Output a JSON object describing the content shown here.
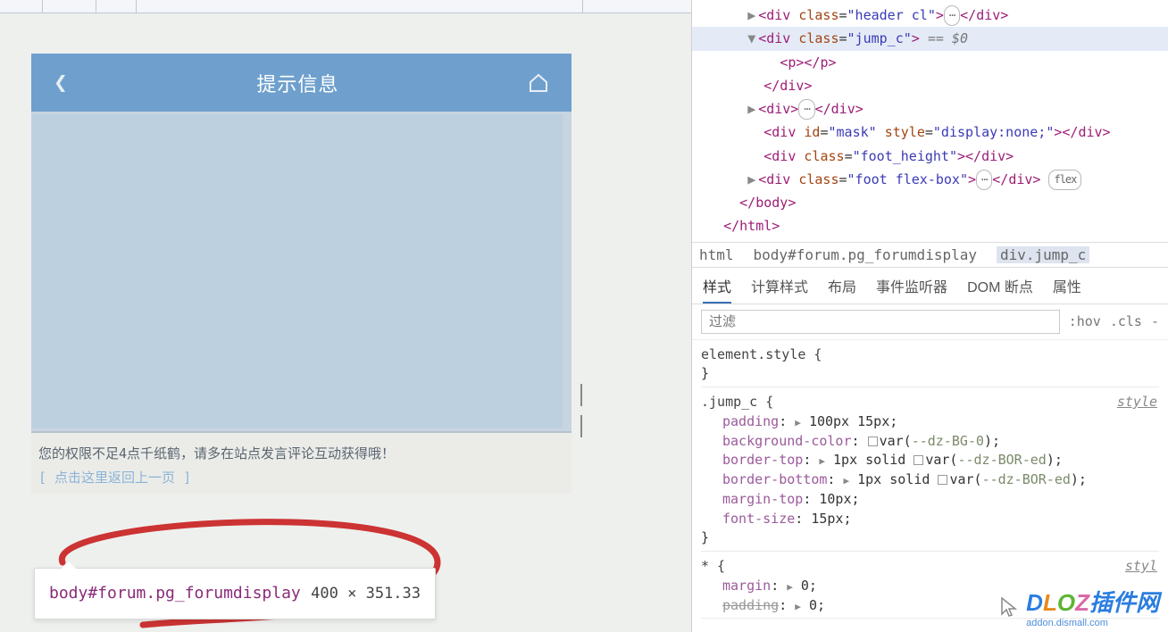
{
  "phone": {
    "title": "提示信息",
    "message_line1": "您的权限不足4点千纸鹤，请多在站点发言评论互动获得哦！",
    "message_line2": "[ 点击这里返回上一页 ]"
  },
  "tooltip": {
    "selector": "body#forum.pg_forumdisplay",
    "dimensions": "400 × 351.33"
  },
  "dom": {
    "l1": "<div class=\"header cl\">",
    "l1b": "</div>",
    "l2": "<div class=\"jump_c\">",
    "l2eq": " == $0",
    "l3": "<p></p>",
    "l4": "</div>",
    "l5": "<div>",
    "l5b": "</div>",
    "l6a": "<div id=\"mask\" style=\"display:none;\"></div>",
    "l7": "<div class=\"foot_height\"></div>",
    "l8": "<div class=\"foot flex-box\">",
    "l8b": "</div>",
    "flex_pill": "flex",
    "l9": "</body>",
    "l10": "</html>"
  },
  "breadcrumb": {
    "b1": "html",
    "b2": "body#forum.pg_forumdisplay",
    "b3": "div.jump_c"
  },
  "tabs": {
    "t1": "样式",
    "t2": "计算样式",
    "t3": "布局",
    "t4": "事件监听器",
    "t5": "DOM 断点",
    "t6": "属性"
  },
  "filter": {
    "placeholder": "过滤",
    "hov": ":hov",
    "cls": ".cls",
    "more": "-"
  },
  "styles": {
    "elem": "element.style {",
    "close": "}",
    "jump_sel": ".jump_c {",
    "src": "style",
    "p1n": "padding",
    "p1v": "100px 15px;",
    "p2n": "background-color",
    "p2var": "--dz-BG-0",
    "p3n": "border-top",
    "p3v1": "1px solid",
    "p3var": "--dz-BOR-ed",
    "p4n": "border-bottom",
    "p4v1": "1px solid",
    "p4var": "--dz-BOR-ed",
    "p5n": "margin-top",
    "p5v": "10px;",
    "p6n": "font-size",
    "p6v": "15px;",
    "star_sel": "* {",
    "star_src": "styl",
    "s1n": "margin",
    "s1v": "0;",
    "s2n": "padding",
    "s2v": "0;"
  },
  "watermark": {
    "brand1": "D",
    "brand2": "L",
    "brand3": "O",
    "brand4": "Z",
    "brand5": "插",
    "brand6": "件",
    "brand7": "网",
    "sub": "addon.dismall.com"
  }
}
